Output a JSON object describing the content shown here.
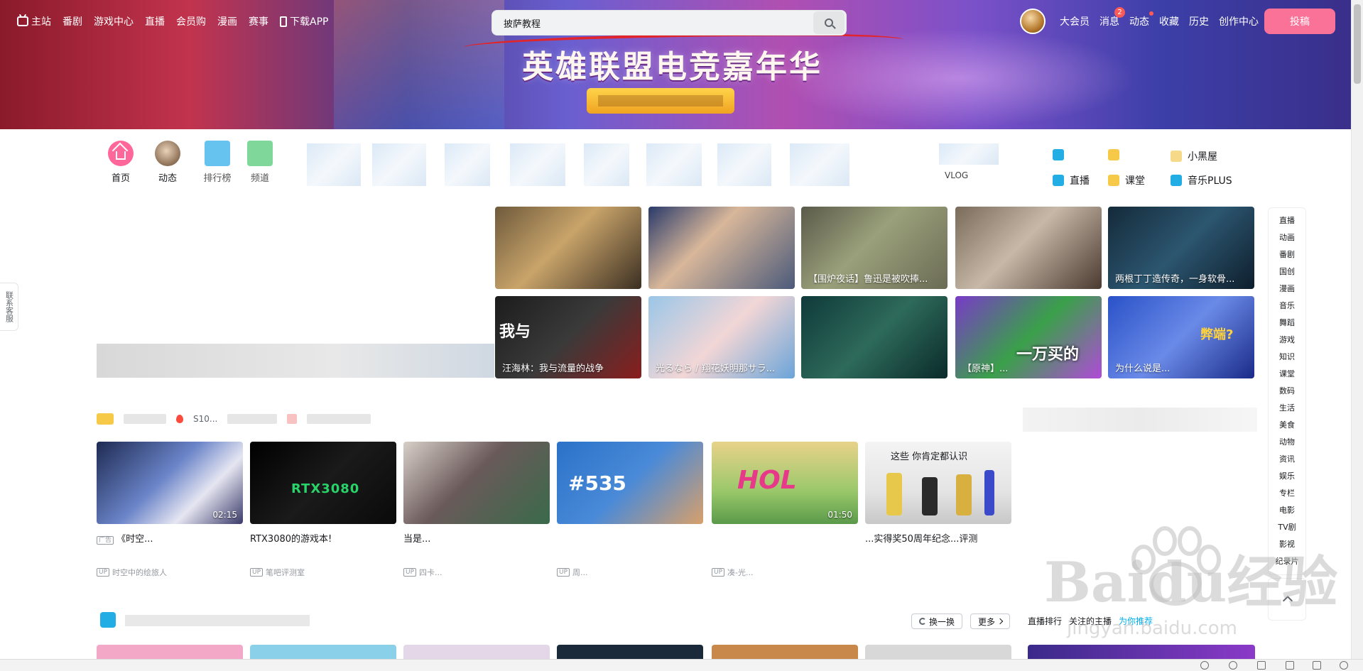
{
  "top_nav": {
    "left_items": [
      {
        "label": "主站",
        "icon": "bilibili-tv-icon"
      },
      {
        "label": "番剧"
      },
      {
        "label": "游戏中心"
      },
      {
        "label": "直播"
      },
      {
        "label": "会员购"
      },
      {
        "label": "漫画"
      },
      {
        "label": "赛事"
      },
      {
        "label": "下载APP",
        "icon": "phone-icon"
      }
    ],
    "search": {
      "value": "披萨教程",
      "icon": "search-icon"
    },
    "right_items": [
      {
        "label": "大会员"
      },
      {
        "label": "消息",
        "badge": "2"
      },
      {
        "label": "动态",
        "dot": true
      },
      {
        "label": "收藏"
      },
      {
        "label": "历史"
      },
      {
        "label": "创作中心"
      }
    ],
    "upload_label": "投稿"
  },
  "banner": {
    "title": "英雄联盟电竞嘉年华"
  },
  "channels": {
    "main": [
      {
        "label": "首页",
        "icon": "home-icon",
        "color": "#ff6699"
      },
      {
        "label": "动态",
        "icon": "avatar"
      }
    ],
    "partial": [
      "排行榜",
      "频道"
    ],
    "extra_partial": [
      "VLOG"
    ],
    "right": [
      {
        "label": "小黑屋",
        "color": "#f7c948"
      },
      {
        "label": "直播",
        "color": "#23ade5"
      },
      {
        "label": "课堂",
        "color": "#f7c948"
      },
      {
        "label": "音乐PLUS",
        "color": "#23ade5"
      }
    ]
  },
  "carousel_grid": {
    "row1": [
      {
        "caption": ""
      },
      {
        "caption": ""
      },
      {
        "caption": "【围炉夜话】鲁迅是被吹捧..."
      },
      {
        "caption": ""
      },
      {
        "caption": "两根丁丁造传奇，一身软骨..."
      }
    ],
    "row2": [
      {
        "caption": "汪海林：我与流量的战争",
        "overlay": "我与"
      },
      {
        "caption": "光るなら / 翔花妖明那サラ..."
      },
      {
        "caption": ""
      },
      {
        "caption": "【原神】...",
        "overlay": "一万买的"
      },
      {
        "caption": "为什么说是...",
        "overlay": "弊端?"
      }
    ]
  },
  "float_nav": [
    "直播",
    "动画",
    "番剧",
    "国创",
    "漫画",
    "音乐",
    "舞蹈",
    "游戏",
    "知识",
    "课堂",
    "数码",
    "生活",
    "美食",
    "动物",
    "资讯",
    "娱乐",
    "专栏",
    "电影",
    "TV剧",
    "影视",
    "纪录片"
  ],
  "left_float": "联系客服",
  "section2": {
    "tags": [
      "S10..."
    ],
    "cards": [
      {
        "title": "《时空...",
        "owner": "时空中的绘旅人",
        "ad": "广告",
        "duration": "02:15"
      },
      {
        "title": "RTX3080的游戏本!",
        "owner": "笔吧评测室",
        "thumb_text": "RTX3080"
      },
      {
        "title": "当是...",
        "owner": "四卡..."
      },
      {
        "title": "",
        "owner": "周...",
        "thumb_text": "#535"
      },
      {
        "title": "",
        "owner": "凑-光...",
        "duration": "01:50",
        "thumb_text": "HOL"
      },
      {
        "title": "...实得奖50周年纪念...评测",
        "owner": "",
        "thumb_text": "这些 你肯定都认识"
      }
    ]
  },
  "section3": {
    "refresh_label": "换一换",
    "more_label": "更多",
    "live_tabs": [
      "直播排行",
      "关注的主播",
      "为你推荐"
    ]
  },
  "watermark": {
    "text": "Baidu经验",
    "sub": "jingyan.baidu.com"
  }
}
